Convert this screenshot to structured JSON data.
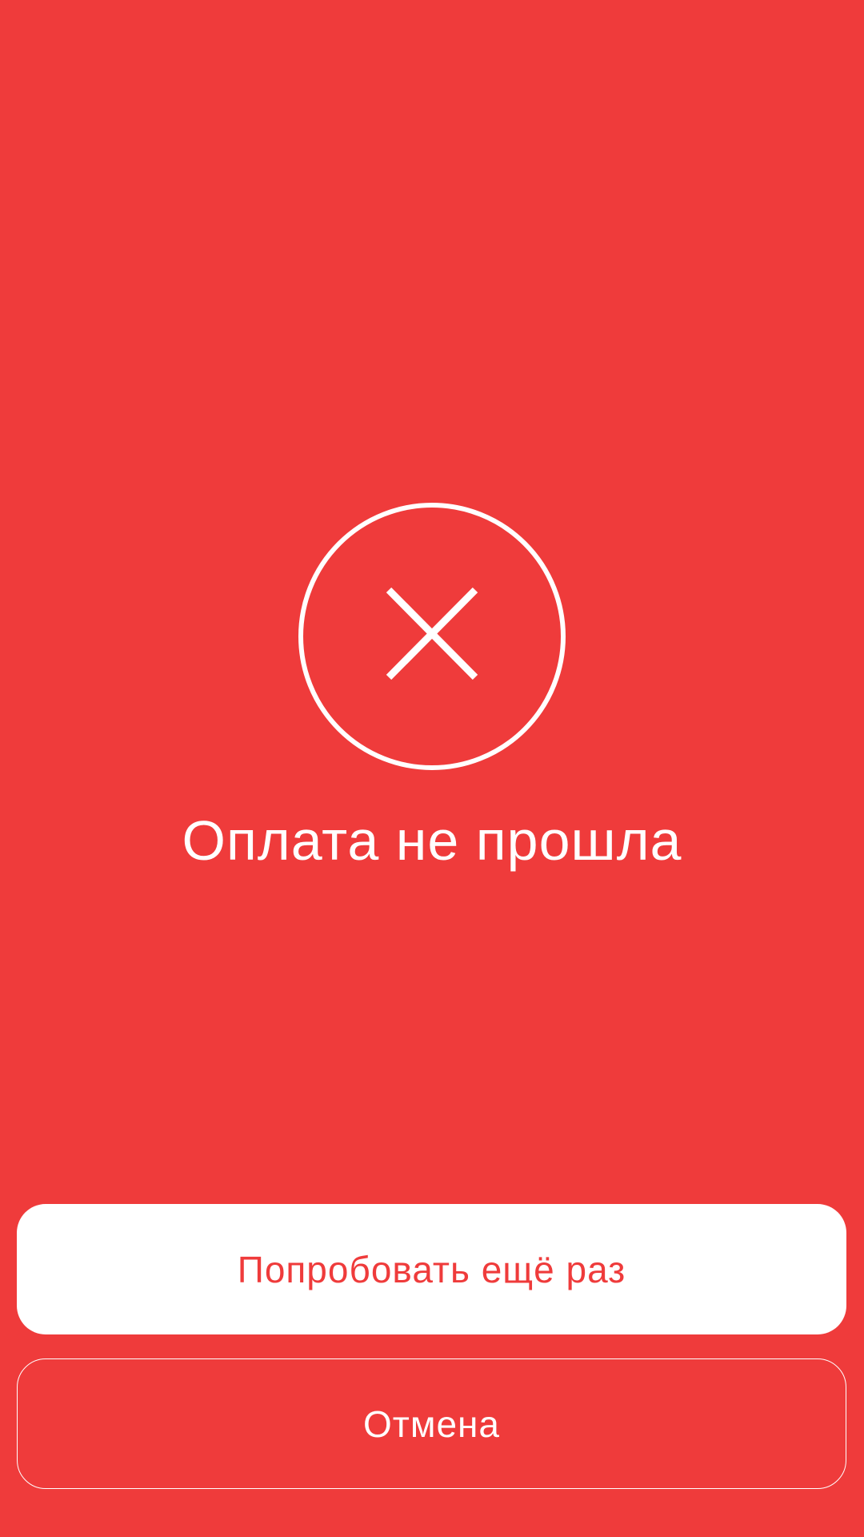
{
  "screen": {
    "background_color": "#EF3B3B",
    "status_icon": "close-circle-icon",
    "title": "Оплата не прошла"
  },
  "actions": {
    "retry_label": "Попробовать ещё раз",
    "cancel_label": "Отмена"
  }
}
